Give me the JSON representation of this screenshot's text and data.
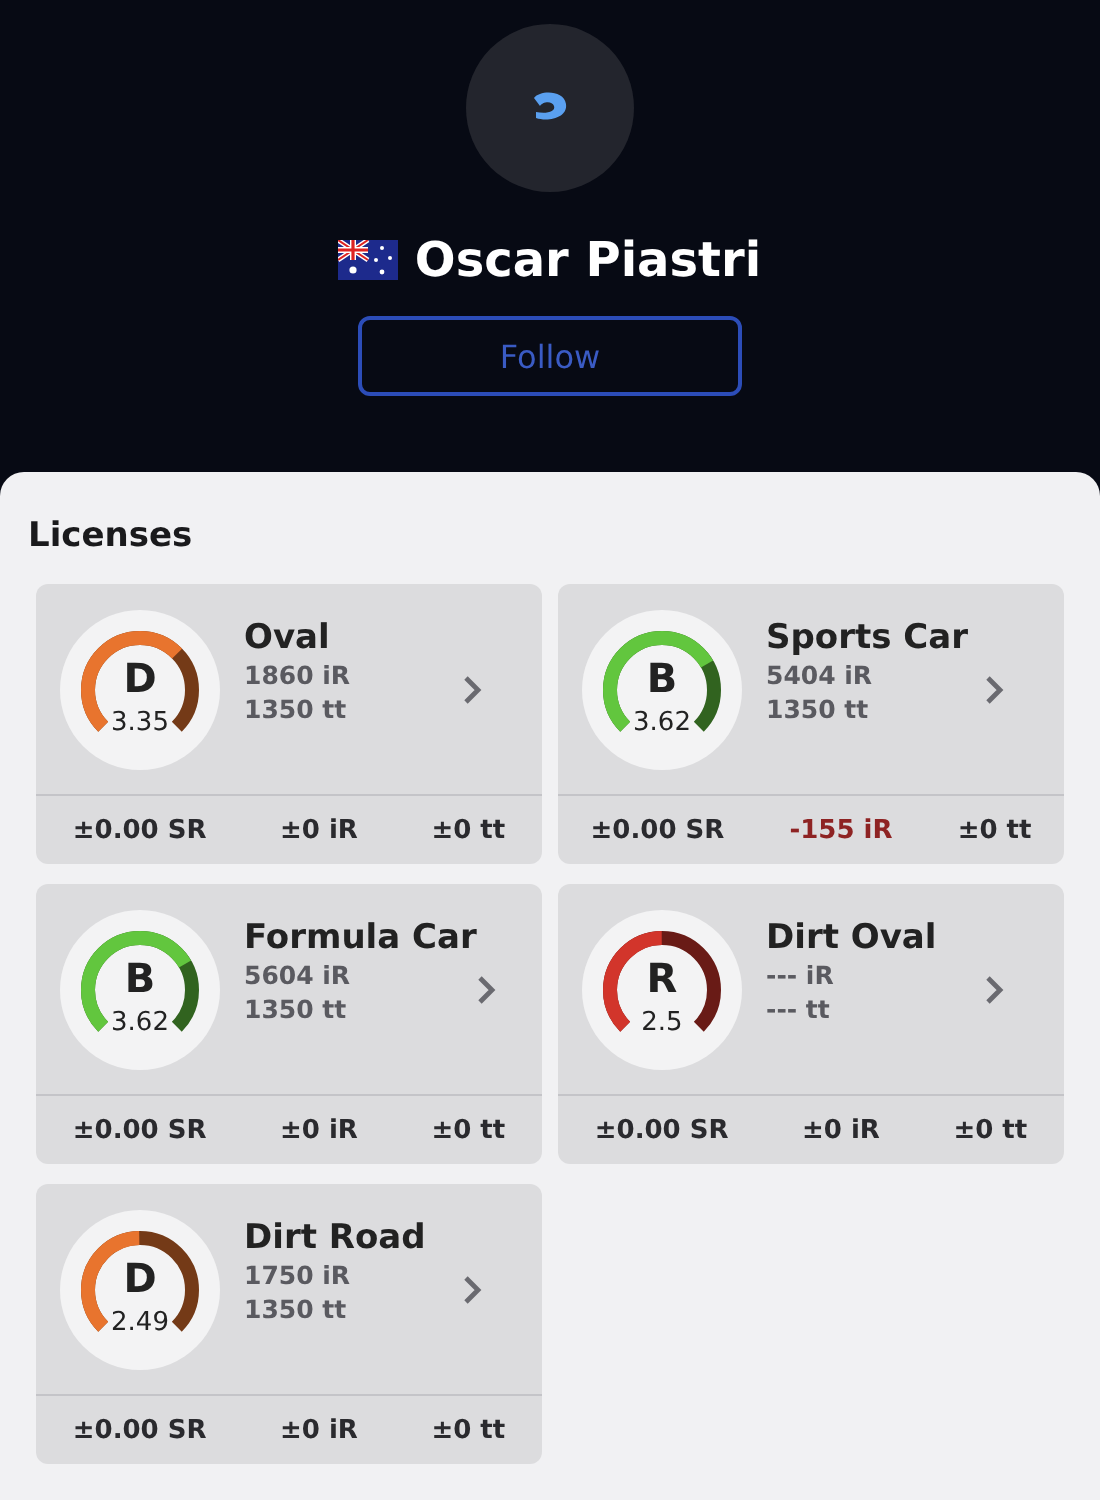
{
  "profile": {
    "name": "Oscar Piastri",
    "follow_button": "Follow"
  },
  "licenses_title": "Licenses",
  "licenses": [
    {
      "category": "Oval",
      "class": "D",
      "sr": "3.35",
      "color": "#e8742e",
      "irating": "1860 iR",
      "tt": "1350 tt",
      "changes": [
        {
          "text": "±0.00 SR",
          "kind": "neutral"
        },
        {
          "text": "±0 iR",
          "kind": "neutral"
        },
        {
          "text": "±0 tt",
          "kind": "neutral"
        }
      ]
    },
    {
      "category": "Sports Car",
      "class": "B",
      "sr": "3.62",
      "color": "#62c63e",
      "irating": "5404 iR",
      "tt": "1350 tt",
      "changes": [
        {
          "text": "±0.00 SR",
          "kind": "neutral"
        },
        {
          "text": "-155 iR",
          "kind": "loss"
        },
        {
          "text": "±0 tt",
          "kind": "neutral"
        }
      ]
    },
    {
      "category": "Formula Car",
      "class": "B",
      "sr": "3.62",
      "color": "#62c63e",
      "irating": "5604 iR",
      "tt": "1350 tt",
      "changes": [
        {
          "text": "±0.00 SR",
          "kind": "neutral"
        },
        {
          "text": "±0 iR",
          "kind": "neutral"
        },
        {
          "text": "±0 tt",
          "kind": "neutral"
        }
      ]
    },
    {
      "category": "Dirt Oval",
      "class": "R",
      "sr": "2.5",
      "color": "#d2352b",
      "irating": "--- iR",
      "tt": "--- tt",
      "changes": [
        {
          "text": "±0.00 SR",
          "kind": "neutral"
        },
        {
          "text": "±0 iR",
          "kind": "neutral"
        },
        {
          "text": "±0 tt",
          "kind": "neutral"
        }
      ]
    },
    {
      "category": "Dirt Road",
      "class": "D",
      "sr": "2.49",
      "color": "#e8742e",
      "irating": "1750 iR",
      "tt": "1350 tt",
      "changes": [
        {
          "text": "±0.00 SR",
          "kind": "neutral"
        },
        {
          "text": "±0 iR",
          "kind": "neutral"
        },
        {
          "text": "±0 tt",
          "kind": "neutral"
        }
      ]
    }
  ]
}
